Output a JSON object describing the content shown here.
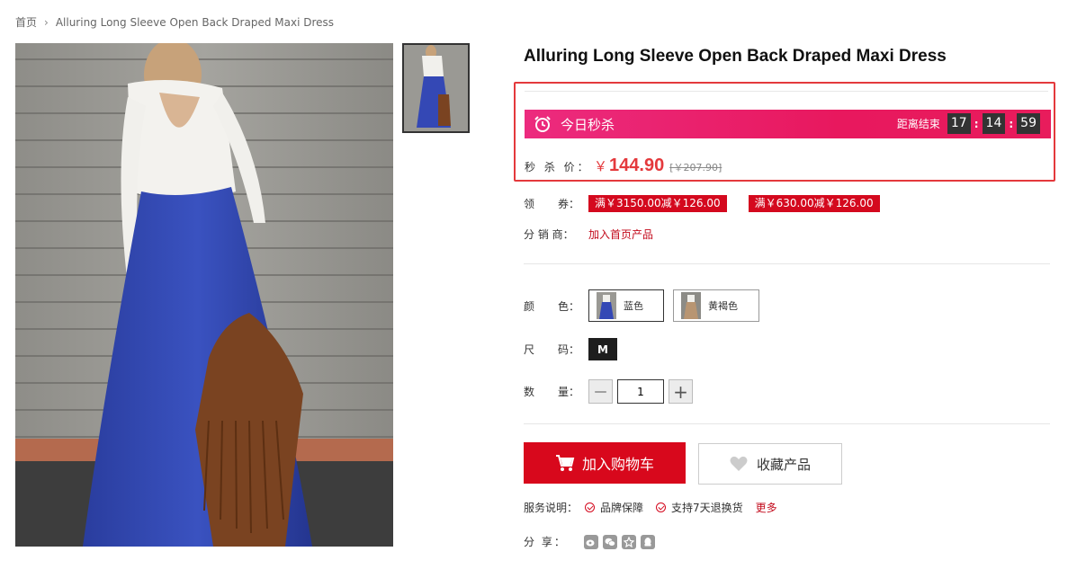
{
  "breadcrumb": {
    "home": "首页",
    "separator": "›",
    "current": "Alluring Long Sleeve Open Back Draped Maxi Dress"
  },
  "product": {
    "title": "Alluring Long Sleeve Open Back Draped Maxi Dress"
  },
  "seckill": {
    "label": "今日秒杀",
    "countdown_label": "距离结束",
    "hours": "17",
    "minutes": "14",
    "seconds": "59",
    "colon": ":",
    "price_label": "秒 杀 价：",
    "currency": "￥",
    "price": "144.90",
    "original_price": "[￥207.90]"
  },
  "coupons": {
    "label_a": "领",
    "label_b": "券：",
    "items": [
      "满￥3150.00减￥126.00",
      "满￥630.00减￥126.00"
    ]
  },
  "distributor": {
    "label": "分 销 商：",
    "link": "加入首页产品"
  },
  "color": {
    "label_a": "颜",
    "label_b": "色：",
    "options": [
      "蓝色",
      "黄褐色"
    ],
    "selected": "蓝色"
  },
  "size": {
    "label_a": "尺",
    "label_b": "码：",
    "options": [
      "M"
    ],
    "selected": "M"
  },
  "quantity": {
    "label_a": "数",
    "label_b": "量：",
    "value": "1",
    "minus": "—",
    "plus": "+"
  },
  "actions": {
    "add_to_cart": "加入购物车",
    "favorite": "收藏产品"
  },
  "service": {
    "label": "服务说明：",
    "items": [
      "品牌保障",
      "支持7天退换货"
    ],
    "more": "更多"
  },
  "share": {
    "label": "分 享：",
    "icons": [
      "weibo-icon",
      "wechat-icon",
      "qzone-icon",
      "qq-icon"
    ]
  },
  "colors": {
    "accent": "#d8081c",
    "seckill_gradient_start": "#ec2b7e",
    "seckill_gradient_end": "#e81c5c",
    "price": "#e4393c"
  }
}
